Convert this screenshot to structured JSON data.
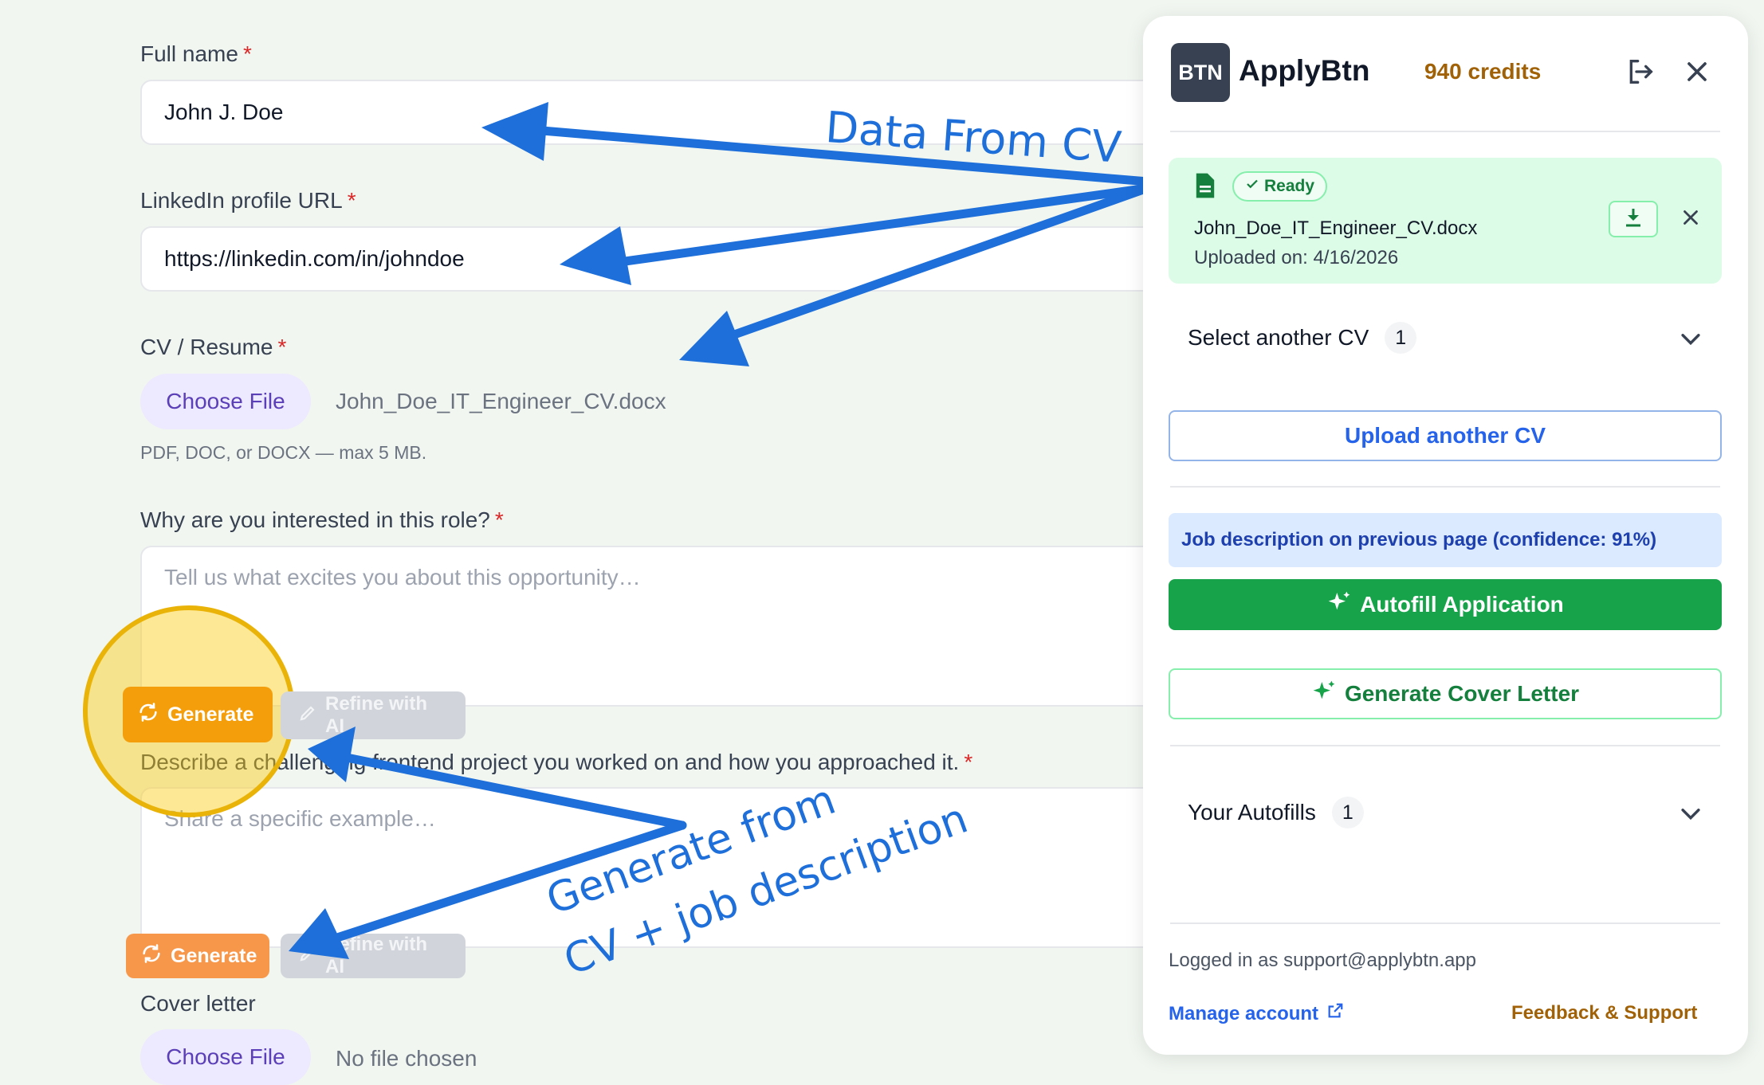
{
  "form": {
    "full_name": {
      "label": "Full name",
      "required": "*",
      "value": "John J. Doe"
    },
    "linkedin": {
      "label": "LinkedIn profile URL",
      "required": "*",
      "value": "https://linkedin.com/in/johndoe"
    },
    "cv": {
      "label": "CV / Resume",
      "required": "*",
      "button": "Choose File",
      "file": "John_Doe_IT_Engineer_CV.docx",
      "hint": "PDF, DOC, or DOCX — max 5 MB."
    },
    "why": {
      "label": "Why are you interested in this role?",
      "required": "*",
      "placeholder": "Tell us what excites you about this opportunity…"
    },
    "describe": {
      "label": "Describe a challenging frontend project you worked on and how you approached it.",
      "required": "*",
      "placeholder": "Share a specific example…"
    },
    "generate_label": "Generate",
    "refine_label": "Refine with AI",
    "cover": {
      "label": "Cover letter",
      "button": "Choose File",
      "file": "No file chosen"
    }
  },
  "annotations": {
    "data_from_cv": "Data From CV",
    "generate_line1": "Generate from",
    "generate_line2": "CV + job description"
  },
  "panel": {
    "logo": "BTN",
    "app_name": "ApplyBtn",
    "credits": "940 credits",
    "cv_card": {
      "status": "Ready",
      "file_name": "John_Doe_IT_Engineer_CV.docx",
      "uploaded": "Uploaded on: 4/16/2026"
    },
    "select_cv": {
      "label": "Select another CV",
      "count": "1"
    },
    "upload_label": "Upload another CV",
    "job_note": "Job description on previous page (confidence: 91%)",
    "autofill_label": "Autofill Application",
    "cover_letter_label": "Generate Cover Letter",
    "your_autofills": {
      "label": "Your Autofills",
      "count": "1"
    },
    "logged_in": "Logged in as support@applybtn.app",
    "manage_account": "Manage account",
    "feedback": "Feedback & Support"
  },
  "colors": {
    "background": "#f1f6f1",
    "accent_green": "#16a34a",
    "accent_blue": "#2563eb",
    "generate_orange": "#f59e0b",
    "credits_gold": "#a16207",
    "annotation_blue": "#1e6fd9",
    "highlight_yellow": "#eab308"
  },
  "icons": [
    "document-icon",
    "check-icon",
    "download-icon",
    "close-icon",
    "logout-icon",
    "chevron-down-icon",
    "sparkle-icon",
    "refresh-icon",
    "pencil-icon",
    "external-link-icon"
  ]
}
